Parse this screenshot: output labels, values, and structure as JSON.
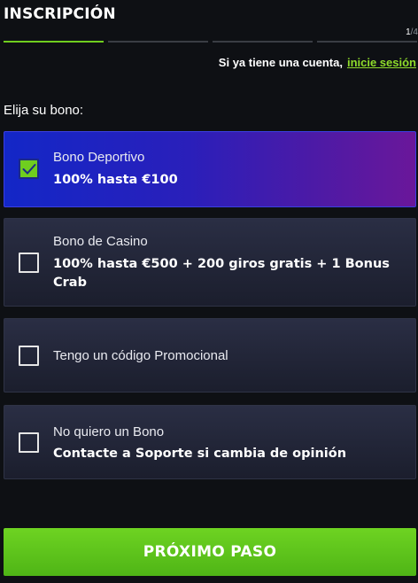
{
  "header": {
    "title": "INSCRIPCIÓN",
    "step_current": "1",
    "step_total": "/4"
  },
  "progress": {
    "current_step": 1,
    "total_steps": 4
  },
  "login": {
    "text": "Si ya tiene una cuenta,",
    "link_label": "inicie sesión"
  },
  "bonus_section": {
    "label": "Elija su bono:",
    "options": [
      {
        "label": "Bono Deportivo",
        "detail": "100% hasta €100",
        "checked": true
      },
      {
        "label": "Bono de Casino",
        "detail": "100% hasta €500 + 200 giros gratis + 1 Bonus Crab",
        "checked": false
      },
      {
        "label": "Tengo un código Promocional",
        "detail": "",
        "checked": false
      },
      {
        "label": "No quiero un Bono",
        "detail": "Contacte a Soporte si cambia de opinión",
        "checked": false
      }
    ]
  },
  "footer": {
    "next_label": "PRÓXIMO PASO"
  },
  "colors": {
    "accent": "#6fce1f",
    "selected_gradient_start": "#1327c7",
    "selected_gradient_end": "#6a179a",
    "background": "#0e1014"
  }
}
